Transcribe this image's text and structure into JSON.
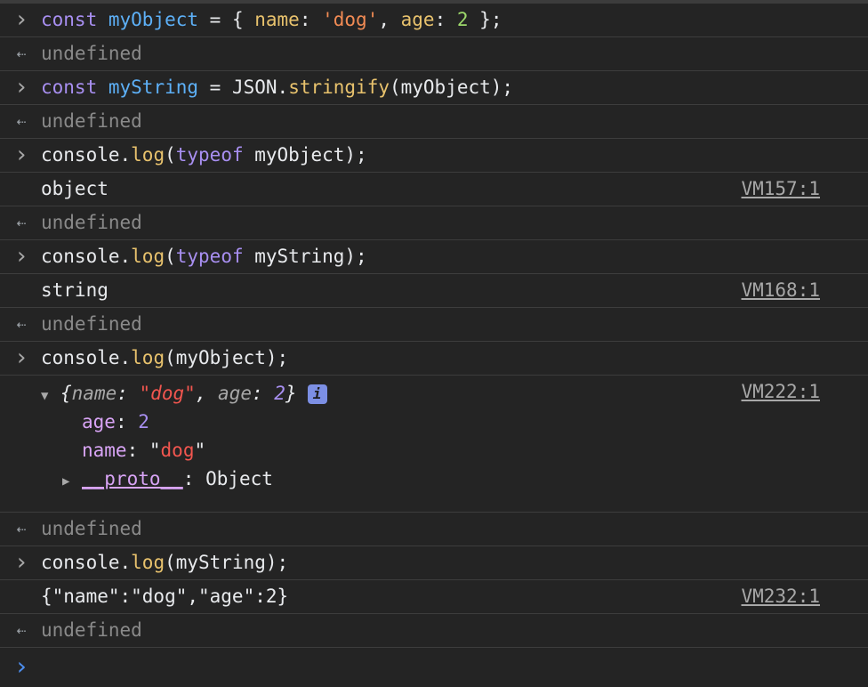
{
  "rows": [
    {
      "kind": "input",
      "tokens": [
        [
          "kw",
          "const"
        ],
        [
          "op",
          " "
        ],
        [
          "var",
          "myObject"
        ],
        [
          "op",
          " = { "
        ],
        [
          "prop",
          "name"
        ],
        [
          "op",
          ": "
        ],
        [
          "str",
          "'dog'"
        ],
        [
          "op",
          ", "
        ],
        [
          "prop",
          "age"
        ],
        [
          "op",
          ": "
        ],
        [
          "num",
          "2"
        ],
        [
          "op",
          " };"
        ]
      ]
    },
    {
      "kind": "return",
      "text": "undefined"
    },
    {
      "kind": "input",
      "tokens": [
        [
          "kw",
          "const"
        ],
        [
          "op",
          " "
        ],
        [
          "var",
          "myString"
        ],
        [
          "op",
          " = JSON."
        ],
        [
          "fn",
          "stringify"
        ],
        [
          "op",
          "(myObject);"
        ]
      ]
    },
    {
      "kind": "return",
      "text": "undefined"
    },
    {
      "kind": "input",
      "tokens": [
        [
          "op",
          "console."
        ],
        [
          "fn",
          "log"
        ],
        [
          "op",
          "("
        ],
        [
          "kw",
          "typeof"
        ],
        [
          "op",
          " myObject);"
        ]
      ]
    },
    {
      "kind": "log",
      "text": "object",
      "source": "VM157:1"
    },
    {
      "kind": "return",
      "text": "undefined"
    },
    {
      "kind": "input",
      "tokens": [
        [
          "op",
          "console."
        ],
        [
          "fn",
          "log"
        ],
        [
          "op",
          "("
        ],
        [
          "kw",
          "typeof"
        ],
        [
          "op",
          " myString);"
        ]
      ]
    },
    {
      "kind": "log",
      "text": "string",
      "source": "VM168:1"
    },
    {
      "kind": "return",
      "text": "undefined"
    },
    {
      "kind": "input",
      "tokens": [
        [
          "op",
          "console."
        ],
        [
          "fn",
          "log"
        ],
        [
          "op",
          "(myObject);"
        ]
      ]
    },
    {
      "kind": "object",
      "source": "VM222:1"
    },
    {
      "kind": "return",
      "text": "undefined"
    },
    {
      "kind": "input",
      "tokens": [
        [
          "op",
          "console."
        ],
        [
          "fn",
          "log"
        ],
        [
          "op",
          "(myString);"
        ]
      ]
    },
    {
      "kind": "log",
      "text": "{\"name\":\"dog\",\"age\":2}",
      "source": "VM232:1"
    },
    {
      "kind": "return",
      "text": "undefined"
    },
    {
      "kind": "prompt"
    }
  ],
  "object_preview": {
    "open_brace": "{",
    "key1": "name",
    "val1": "\"dog\"",
    "key2": "age",
    "val2": "2",
    "close_brace": "}",
    "info": "i",
    "age_key": "age",
    "age_val": "2",
    "name_key": "name",
    "name_val_open": "\"",
    "name_val": "dog",
    "name_val_close": "\"",
    "proto_key": "__proto__",
    "proto_val": "Object"
  },
  "icons": {
    "input": "chevron-right-icon",
    "return": "return-arrow-icon",
    "prompt": "prompt-caret-icon",
    "expand_open": "triangle-down-icon",
    "expand_closed": "triangle-right-icon",
    "info": "info-icon"
  },
  "colors": {
    "background": "#242424",
    "keyword": "#a88ff1",
    "variable": "#5db0f7",
    "property": "#e8c26d",
    "string": "#f28b54",
    "number": "#9dd86b",
    "prompt": "#4d8ff0"
  }
}
